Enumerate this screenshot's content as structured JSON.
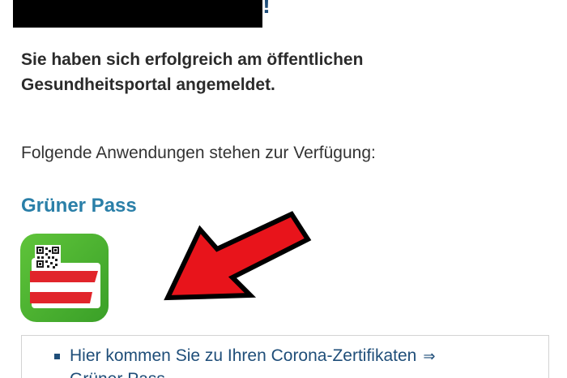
{
  "header": {
    "greeting_punct": "!"
  },
  "main": {
    "success_message": "Sie haben sich erfolgreich am öffentlichen Gesundheitsportal angemeldet.",
    "apps_intro": "Folgende Anwendungen stehen zur Verfügung:",
    "app": {
      "title": "Grüner Pass",
      "icon": "gruener-pass-app-icon"
    },
    "links": [
      {
        "label": "Hier kommen Sie zu Ihren Corona-Zertifikaten",
        "arrow": "⇒"
      }
    ],
    "link_partial": "Grüner Pass"
  },
  "colors": {
    "link": "#1f4e79",
    "heading": "#2a7fa8",
    "app_green": "#4db332",
    "annotation_arrow": "#e8141b"
  }
}
